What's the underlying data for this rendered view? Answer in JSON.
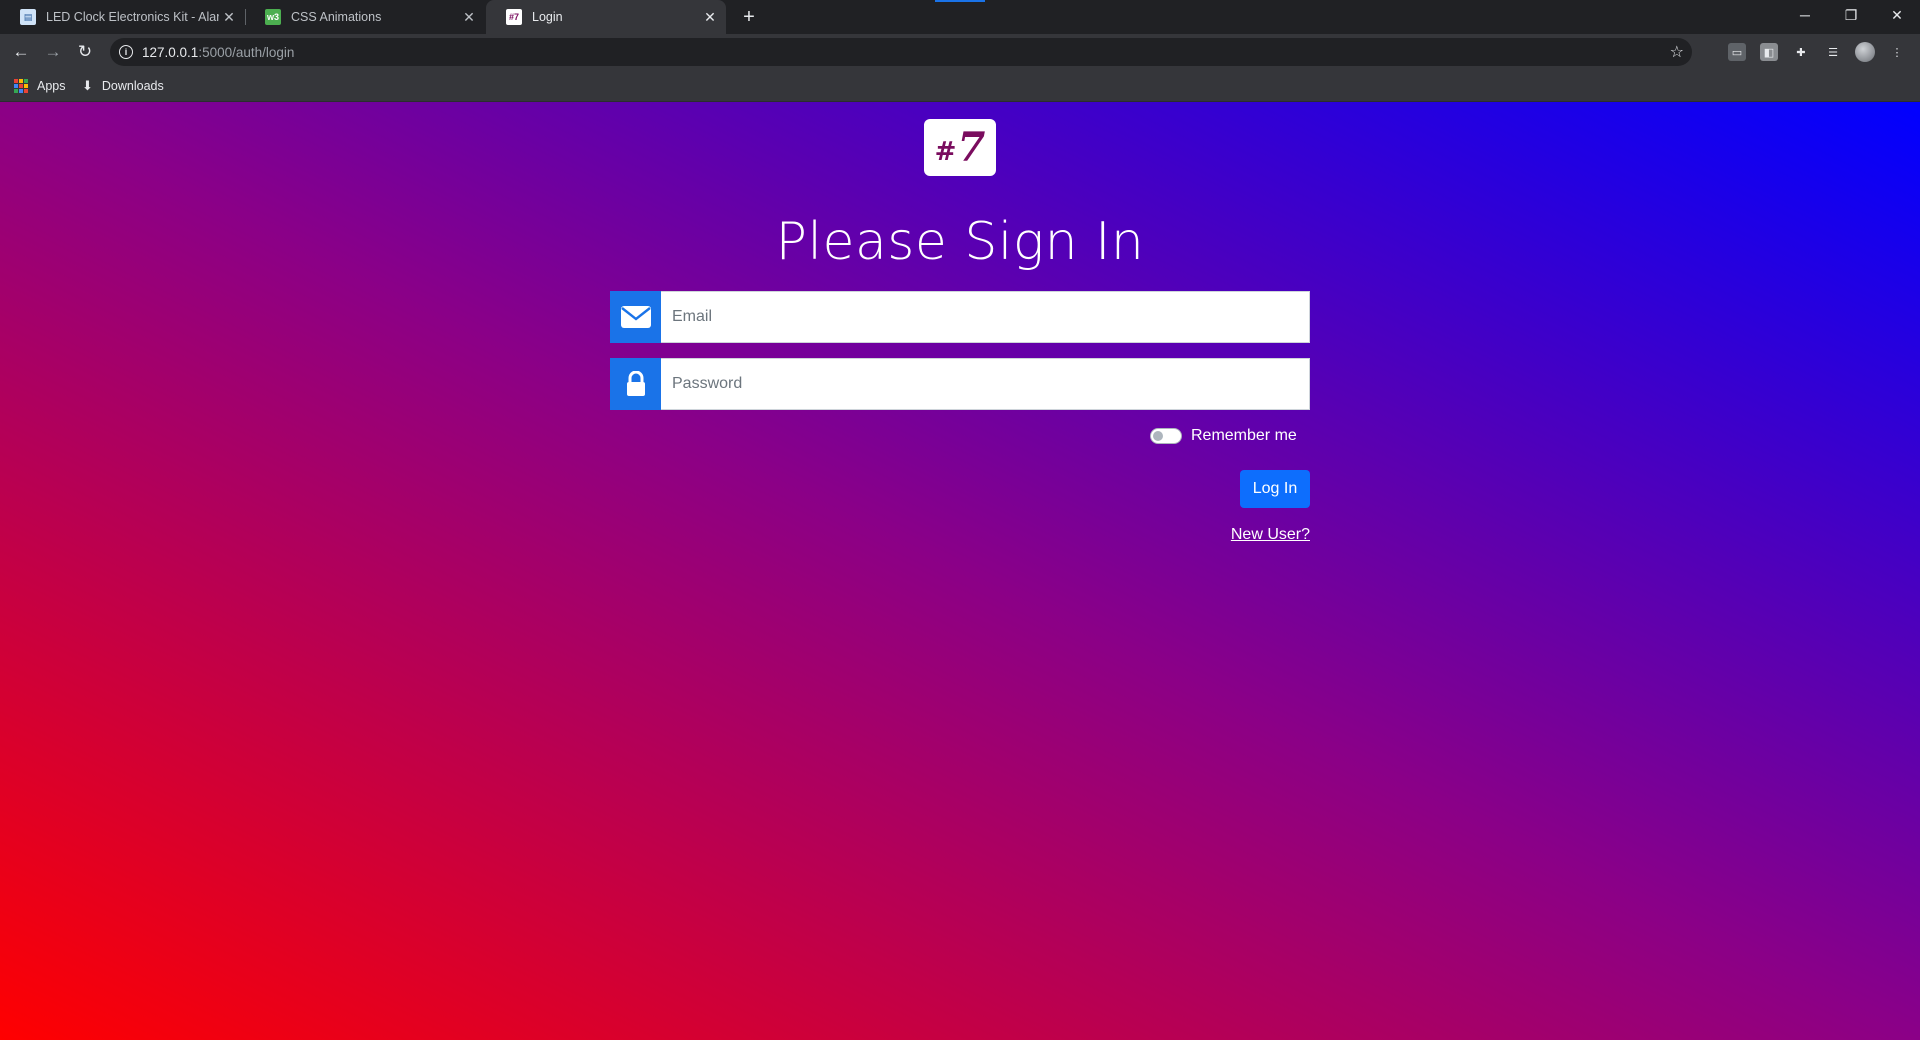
{
  "browser": {
    "tabs": [
      {
        "title": "LED Clock Electronics Kit - Alarm",
        "favicon": "page-favicon",
        "active": false
      },
      {
        "title": "CSS Animations",
        "favicon": "w3-favicon",
        "active": false
      },
      {
        "title": "Login",
        "favicon": "hash7-favicon",
        "active": true
      }
    ],
    "new_tab_glyph": "+",
    "window_controls": {
      "minimize": "─",
      "restore": "❐",
      "close": "✕"
    },
    "close_glyph": "✕",
    "nav": {
      "back": "←",
      "forward": "→",
      "reload": "↻"
    },
    "url": {
      "host": "127.0.0.1",
      "path": ":5000/auth/login"
    },
    "info_glyph": "i",
    "star_glyph": "☆",
    "bookmarks": [
      {
        "label": "Apps",
        "icon": "apps-grid-icon"
      },
      {
        "label": "Downloads",
        "icon": "download-icon"
      }
    ],
    "colors": {
      "frame": "#202124",
      "toolbar": "#35363a",
      "accent": "#1a73e8"
    }
  },
  "page": {
    "logo": {
      "hash": "#",
      "seven": "7"
    },
    "heading": "Please Sign In",
    "email": {
      "placeholder": "Email",
      "value": "",
      "icon": "envelope-icon"
    },
    "password": {
      "placeholder": "Password",
      "value": "",
      "icon": "lock-icon"
    },
    "remember_label": "Remember me",
    "remember_checked": false,
    "login_button": "Log In",
    "new_user_link": "New User?",
    "colors": {
      "gradient_start": "#ff0000",
      "gradient_mid": "#8b0087",
      "gradient_end": "#0000ff",
      "input_prefix": "#1a73e8",
      "button": "#0d6efd"
    }
  }
}
